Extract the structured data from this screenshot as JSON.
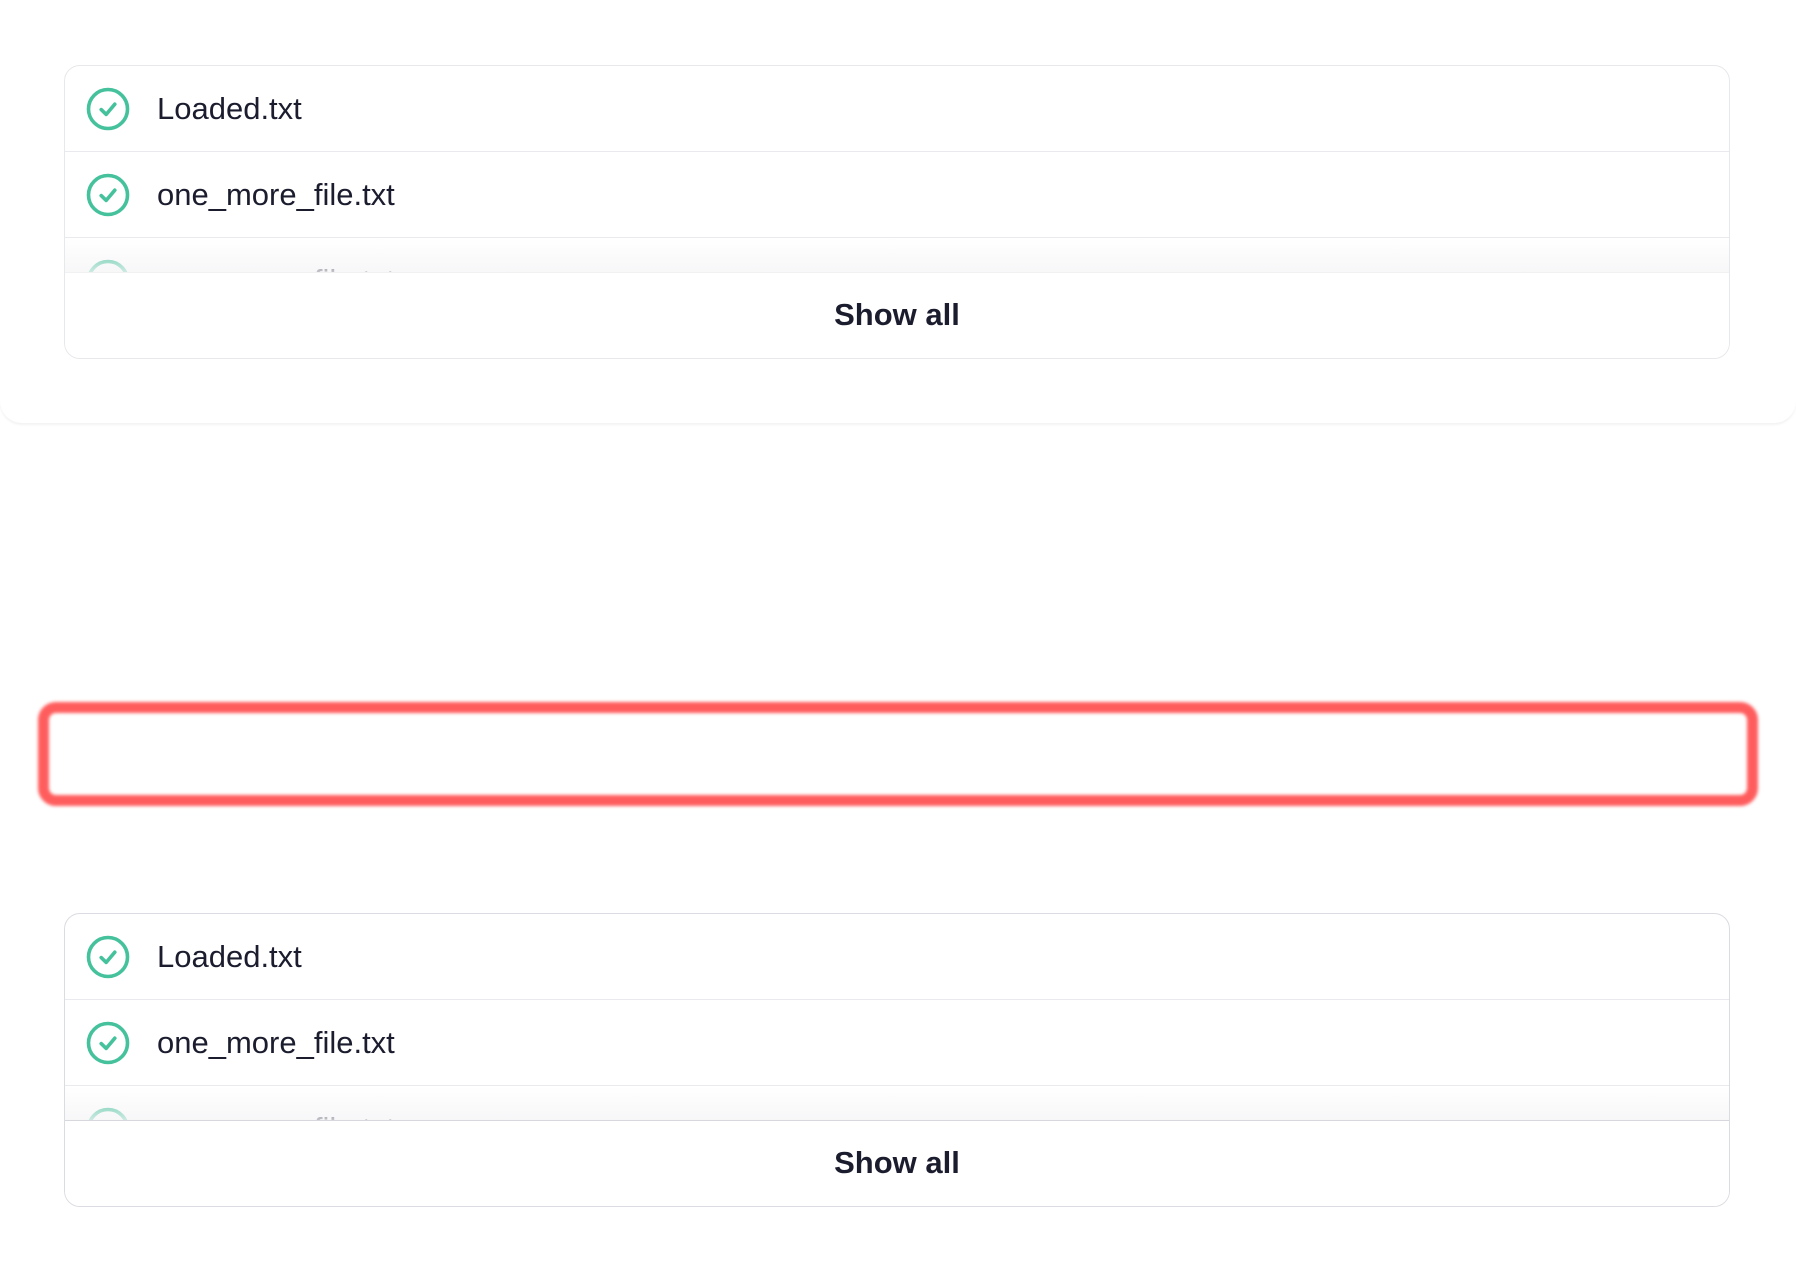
{
  "colors": {
    "check": "#45c29c",
    "text": "#1b1d2e",
    "highlight": "#ff5d5d",
    "border": "#e6e8ec"
  },
  "top_panel": {
    "files": [
      {
        "name": "Loaded.txt",
        "icon": "check-circle-icon"
      },
      {
        "name": "one_more_file.txt",
        "icon": "check-circle-icon"
      },
      {
        "name": "one_more_file.txt",
        "icon": "check-circle-icon"
      }
    ],
    "show_all_label": "Show all"
  },
  "bottom_panel": {
    "files": [
      {
        "name": "Loaded.txt",
        "icon": "check-circle-icon"
      },
      {
        "name": "one_more_file.txt",
        "icon": "check-circle-icon"
      },
      {
        "name": "one_more_file.txt",
        "icon": "check-circle-icon"
      }
    ],
    "show_all_label": "Show all"
  }
}
